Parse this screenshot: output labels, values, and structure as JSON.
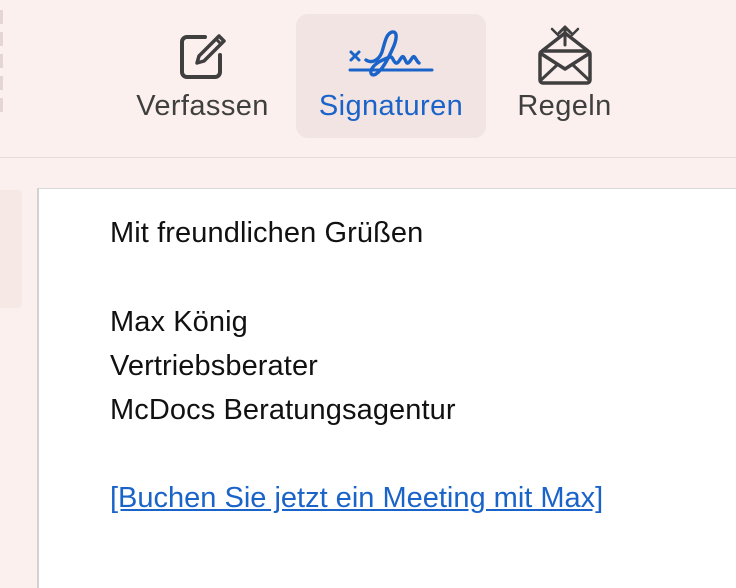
{
  "toolbar": {
    "tabs": [
      {
        "label": "Verfassen",
        "icon": "compose-icon"
      },
      {
        "label": "Signaturen",
        "icon": "signature-icon",
        "active": true
      },
      {
        "label": "Regeln",
        "icon": "envelope-rules-icon"
      }
    ]
  },
  "signature": {
    "greeting": "Mit freundlichen Grüßen",
    "name": "Max König",
    "role": "Vertriebsberater",
    "company": "McDocs Beratungsagentur",
    "link_text": "[Buchen Sie jetzt ein Meeting mit Max]"
  },
  "colors": {
    "accent": "#1a63c9",
    "toolbar_bg": "#fbf0ee",
    "active_tab_bg": "#f1e4e2"
  }
}
